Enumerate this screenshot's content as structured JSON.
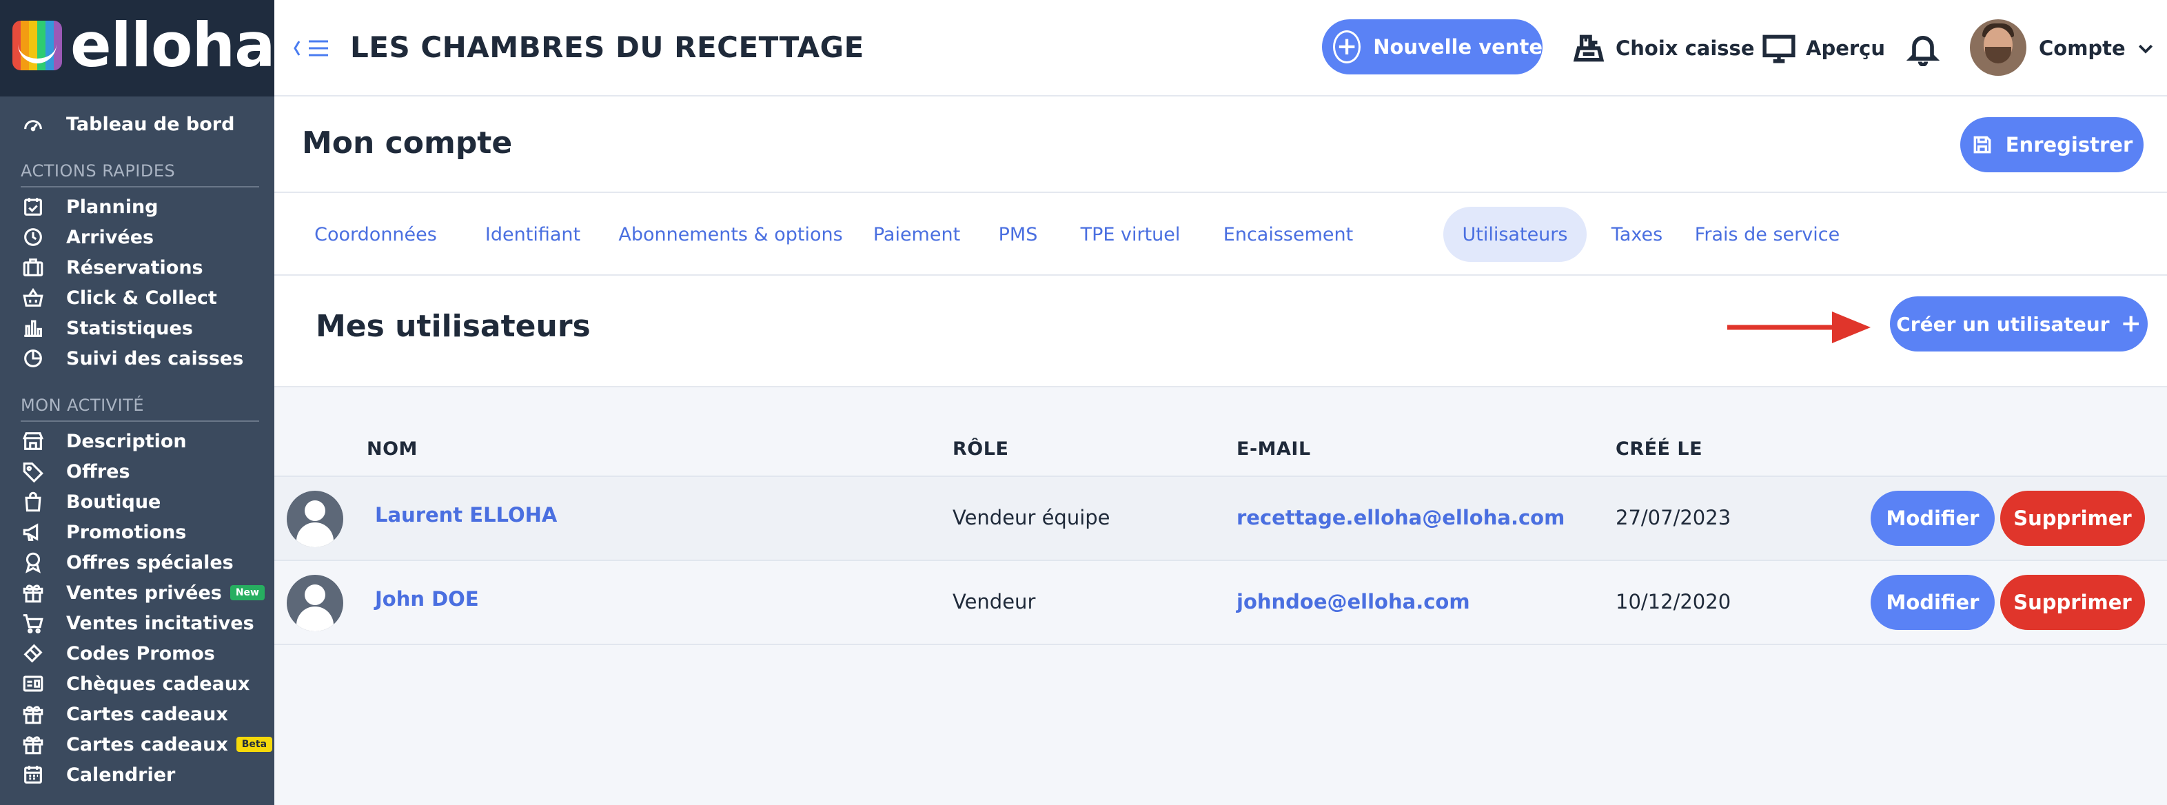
{
  "app": {
    "brand": "elloha",
    "accent": "#5a82f5",
    "danger": "#e0352b",
    "sidebar_bg": "#3b4a5e"
  },
  "sidebar": {
    "dashboard": {
      "label": "Tableau de bord",
      "icon": "gauge-icon"
    },
    "quick_actions_title": "ACTIONS RAPIDES",
    "quick_actions": [
      {
        "label": "Planning",
        "icon": "calendar-check-icon"
      },
      {
        "label": "Arrivées",
        "icon": "clock-icon"
      },
      {
        "label": "Réservations",
        "icon": "suitcase-icon"
      },
      {
        "label": "Click & Collect",
        "icon": "basket-icon"
      },
      {
        "label": "Statistiques",
        "icon": "bar-chart-icon"
      },
      {
        "label": "Suivi des caisses",
        "icon": "pie-chart-icon"
      }
    ],
    "activity_title": "MON ACTIVITÉ",
    "activity": [
      {
        "label": "Description",
        "icon": "storefront-icon"
      },
      {
        "label": "Offres",
        "icon": "tag-icon"
      },
      {
        "label": "Boutique",
        "icon": "shopping-bag-icon"
      },
      {
        "label": "Promotions",
        "icon": "megaphone-icon"
      },
      {
        "label": "Offres spéciales",
        "icon": "award-icon"
      },
      {
        "label": "Ventes privées",
        "icon": "gift-icon",
        "badge": "New"
      },
      {
        "label": "Ventes incitatives",
        "icon": "cart-icon"
      },
      {
        "label": "Codes Promos",
        "icon": "ticket-icon"
      },
      {
        "label": "Chèques cadeaux",
        "icon": "card-icon"
      },
      {
        "label": "Cartes cadeaux",
        "icon": "gift-icon"
      },
      {
        "label": "Cartes cadeaux",
        "icon": "gift-icon",
        "badge": "Beta"
      },
      {
        "label": "Calendrier",
        "icon": "calendar-icon"
      }
    ]
  },
  "topbar": {
    "title": "LES CHAMBRES DU RECETTAGE",
    "new_sale": "Nouvelle vente",
    "register_choice": "Choix caisse",
    "preview": "Aperçu",
    "account": "Compte"
  },
  "page": {
    "title": "Mon compte",
    "save": "Enregistrer"
  },
  "tabs": [
    {
      "label": "Coordonnées",
      "active": false
    },
    {
      "label": "Identifiant",
      "active": false
    },
    {
      "label": "Abonnements & options",
      "active": false
    },
    {
      "label": "Paiement",
      "active": false
    },
    {
      "label": "PMS",
      "active": false
    },
    {
      "label": "TPE virtuel",
      "active": false
    },
    {
      "label": "Encaissement",
      "active": false
    },
    {
      "label": "Utilisateurs",
      "active": true
    },
    {
      "label": "Taxes",
      "active": false
    },
    {
      "label": "Frais de service",
      "active": false
    }
  ],
  "users": {
    "title": "Mes utilisateurs",
    "create": "Créer un utilisateur",
    "create_icon": "+",
    "columns": {
      "name": "NOM",
      "role": "RÔLE",
      "email": "E-MAIL",
      "created": "CRÉÉ LE"
    },
    "rows": [
      {
        "name": "Laurent ELLOHA",
        "role": "Vendeur équipe",
        "email": "recettage.elloha@elloha.com",
        "created": "27/07/2023",
        "edit": "Modifier",
        "delete": "Supprimer"
      },
      {
        "name": "John DOE",
        "role": "Vendeur",
        "email": "johndoe@elloha.com",
        "created": "10/12/2020",
        "edit": "Modifier",
        "delete": "Supprimer"
      }
    ]
  }
}
